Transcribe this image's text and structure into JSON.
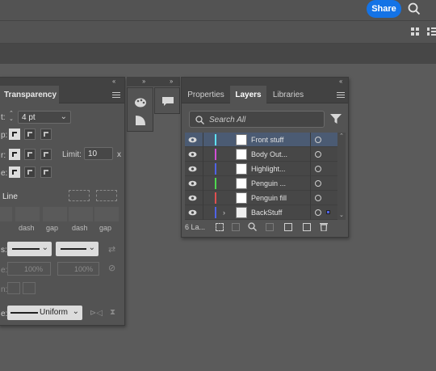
{
  "topbar": {
    "share_label": "Share"
  },
  "stroke_panel": {
    "tab_label": "Transparency",
    "weight_label": "t:",
    "weight_value": "4 pt",
    "cap_label": "p:",
    "corner_label": "r:",
    "limit_label": "Limit:",
    "limit_value": "10",
    "limit_unit": "x",
    "align_label": "e:",
    "dashed_label": "Line",
    "dash_gap_labels": [
      "dash",
      "gap",
      "dash",
      "gap",
      "dash",
      "gap"
    ],
    "arrowheads_label": "s:",
    "scale_label": "e:",
    "scale1": "100%",
    "scale2": "100%",
    "align2_label": "n:",
    "profile_label": "e:",
    "profile_value": "Uniform"
  },
  "layers_panel": {
    "tabs": [
      {
        "label": "Properties",
        "active": false
      },
      {
        "label": "Layers",
        "active": true
      },
      {
        "label": "Libraries",
        "active": false
      }
    ],
    "search_placeholder": "Search All",
    "layers": [
      {
        "name": "Front stuff",
        "color": "#5fe2f2",
        "selected": true,
        "expandable": false
      },
      {
        "name": "Body Out...",
        "color": "#d24fd6",
        "selected": false,
        "expandable": false
      },
      {
        "name": "Highlight...",
        "color": "#4f63e6",
        "selected": false,
        "expandable": false
      },
      {
        "name": "Penguin ...",
        "color": "#4fd84f",
        "selected": false,
        "expandable": false
      },
      {
        "name": "Penguin fill",
        "color": "#e05050",
        "selected": false,
        "expandable": false
      },
      {
        "name": "BackStuff",
        "color": "#4f63e6",
        "selected": false,
        "expandable": true
      }
    ],
    "layer_count": "6 La..."
  }
}
